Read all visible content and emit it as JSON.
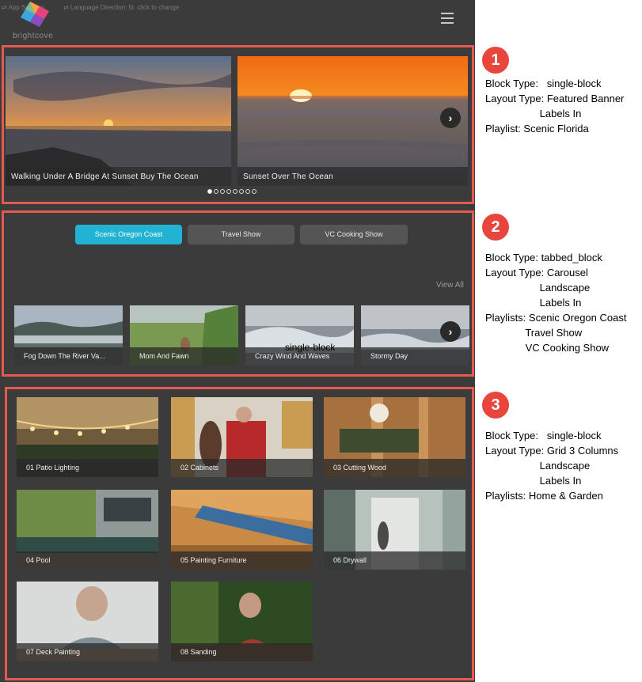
{
  "topbar": {
    "app_selector": "⇄ App Selector",
    "language_direction": "⇄ Language Direction: ltr, click to change",
    "logo_text": "brightcove"
  },
  "banner": {
    "items": [
      {
        "label": "Walking Under A Bridge At Sunset Buy The Ocean"
      },
      {
        "label": "Sunset Over The Ocean"
      }
    ],
    "dots_count": 8,
    "active_dot": 0
  },
  "tabs": {
    "items": [
      {
        "label": "Scenic Oregon Coast",
        "active": true
      },
      {
        "label": "Travel Show",
        "active": false
      },
      {
        "label": "VC Cooking Show",
        "active": false
      }
    ],
    "view_all": "View All",
    "overlay_text": "single-block"
  },
  "carousel": {
    "items": [
      {
        "label": "Fog Down The River Va..."
      },
      {
        "label": "Mom And Fawn"
      },
      {
        "label": "Crazy Wind And Waves"
      },
      {
        "label": "Stormy Day"
      }
    ]
  },
  "grid": {
    "items": [
      {
        "label": "01 Patio Lighting"
      },
      {
        "label": "02 Cabinets"
      },
      {
        "label": "03 Cutting Wood"
      },
      {
        "label": "04 Pool"
      },
      {
        "label": "05 Painting Furniture"
      },
      {
        "label": "06 Drywall"
      },
      {
        "label": "07 Deck Painting"
      },
      {
        "label": "08 Sanding"
      }
    ]
  },
  "annotations": [
    {
      "number": "1",
      "text": "Block Type:   single-block\nLayout Type: Featured Banner\n                   Labels In\nPlaylist: Scenic Florida"
    },
    {
      "number": "2",
      "text": "Block Type: tabbed_block\nLayout Type: Carousel\n                   Landscape\n                   Labels In\nPlaylists: Scenic Oregon Coast\n              Travel Show\n              VC Cooking Show"
    },
    {
      "number": "3",
      "text": "Block Type:   single-block\nLayout Type: Grid 3 Columns\n                   Landscape\n                   Labels In\nPlaylists: Home & Garden"
    }
  ],
  "colors": {
    "panel_bg": "#3b3b3b",
    "accent_tab": "#22b2d4",
    "annotation_red": "#e8453c",
    "box_border": "#e25a52"
  },
  "icons": [
    "hamburger-menu-icon",
    "chevron-right-icon",
    "brightcove-logo"
  ]
}
